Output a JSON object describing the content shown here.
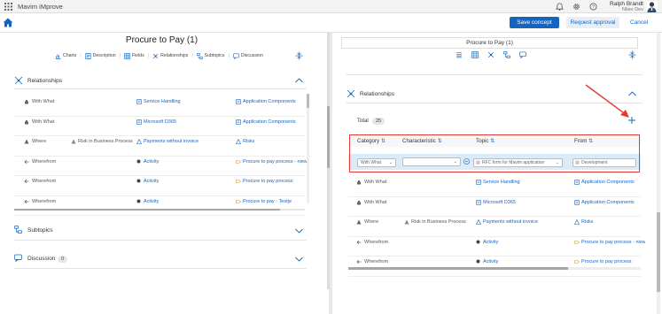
{
  "app": {
    "name": "Mavim iMprove"
  },
  "user": {
    "name": "Ralph Brandt",
    "org": "Nbev Dev"
  },
  "actions": {
    "save": "Save concept",
    "request": "Request approval",
    "cancel": "Cancel"
  },
  "left": {
    "title": "Procure to Pay (1)",
    "tabs": [
      {
        "label": "Charts",
        "icon": "chart-icon"
      },
      {
        "label": "Description",
        "icon": "description-icon"
      },
      {
        "label": "Fields",
        "icon": "fields-icon"
      },
      {
        "label": "Relationships",
        "icon": "relationships-icon"
      },
      {
        "label": "Subtopics",
        "icon": "subtopics-icon"
      },
      {
        "label": "Discussion",
        "icon": "discussion-icon"
      }
    ],
    "relationships": {
      "title": "Relationships",
      "rows": [
        {
          "category": "With What",
          "characteristic": "",
          "topic": "Service Handling",
          "from": "Application Components"
        },
        {
          "category": "With What",
          "characteristic": "",
          "topic": "Microsoft D365",
          "from": "Application Components"
        },
        {
          "category": "Where",
          "characteristic": "Risk in Business Process",
          "topic": "Payments without invoice",
          "from": "Risks"
        },
        {
          "category": "Wherefrom",
          "characteristic": "",
          "topic": "Activity",
          "from": "Procure to pay process - niew"
        },
        {
          "category": "Wherefrom",
          "characteristic": "",
          "topic": "Activity",
          "from": "Procure to pay process"
        },
        {
          "category": "Wherefrom",
          "characteristic": "",
          "topic": "Activity",
          "from": "Procure to pay - Testje"
        }
      ]
    },
    "subtopics": {
      "title": "Subtopics"
    },
    "discussion": {
      "title": "Discussion",
      "count": "0"
    }
  },
  "right": {
    "title": "Procure to Pay (1)",
    "relationships": {
      "title": "Relationships",
      "total_label": "Total",
      "total": "25",
      "columns": [
        "Category",
        "Characteristic",
        "Topic",
        "From"
      ],
      "edit_row": {
        "category": "With What",
        "characteristic": "",
        "topic": "RFC form for Mavim application",
        "from": "Development"
      },
      "rows": [
        {
          "category": "With What",
          "characteristic": "",
          "topic": "Service Handling",
          "from": "Application Components"
        },
        {
          "category": "With What",
          "characteristic": "",
          "topic": "Microsoft D365",
          "from": "Application Components"
        },
        {
          "category": "Where",
          "characteristic": "Risk in Business Process",
          "topic": "Payments without invoice",
          "from": "Risks"
        },
        {
          "category": "Wherefrom",
          "characteristic": "",
          "topic": "Activity",
          "from": "Procure to pay process - niew"
        },
        {
          "category": "Wherefrom",
          "characteristic": "",
          "topic": "Activity",
          "from": "Procure to pay process"
        }
      ]
    }
  },
  "colors": {
    "accent": "#1565c0",
    "highlight": "#e53935",
    "edit_row_bg": "#dcebf8"
  }
}
